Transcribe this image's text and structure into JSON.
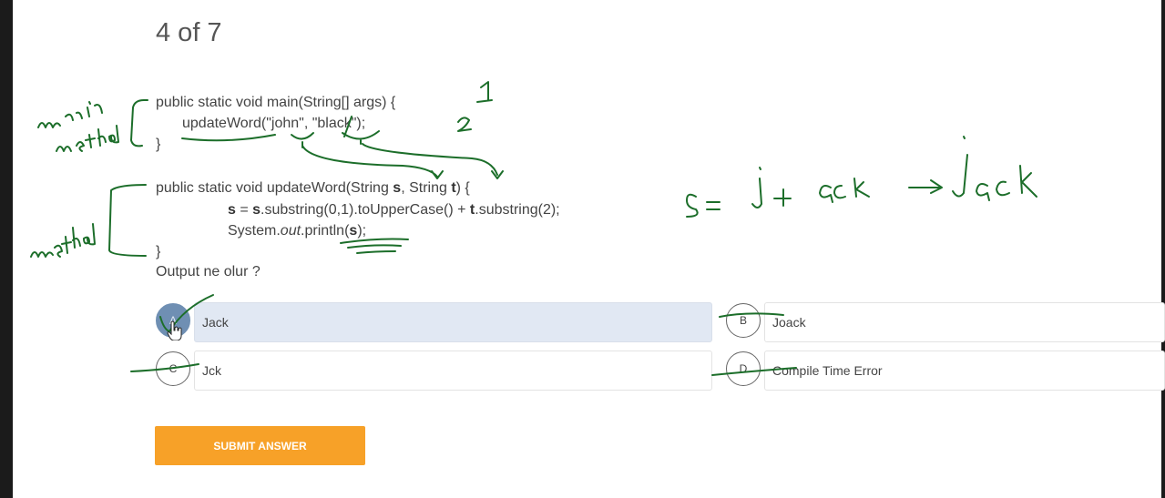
{
  "quiz": {
    "progress": "4 of 7",
    "question": "Output ne olur ?",
    "submit_label": "SUBMIT ANSWER"
  },
  "code": {
    "main_sig": "public static void main(String[] args) {",
    "main_call": "updateWord(\"john\", \"black\");",
    "close": "}",
    "method_sig_a": "public static void updateWord(String ",
    "param_s": "s",
    "method_sig_b": ", String ",
    "param_t": "t",
    "method_sig_c": ") {",
    "assign_s": "s",
    "assign_eq": " = ",
    "assign_s2": "s",
    "assign_mid": ".substring(0,1).toUpperCase() + ",
    "assign_t": "t",
    "assign_end": ".substring(2);",
    "print_a": "System.",
    "print_out": "out",
    "print_b": ".println(",
    "print_s": "s",
    "print_c": ");"
  },
  "options": [
    {
      "letter": "A",
      "text": "Jack",
      "selected": true
    },
    {
      "letter": "B",
      "text": "Joack",
      "selected": false
    },
    {
      "letter": "C",
      "text": "Jck",
      "selected": false
    },
    {
      "letter": "D",
      "text": "Compile Time Error",
      "selected": false
    }
  ],
  "colors": {
    "submit": "#f7a128",
    "selected_option": "#e1e8f3",
    "selected_circle": "#6f8fb3",
    "annotation_ink": "#1c6e2a"
  }
}
